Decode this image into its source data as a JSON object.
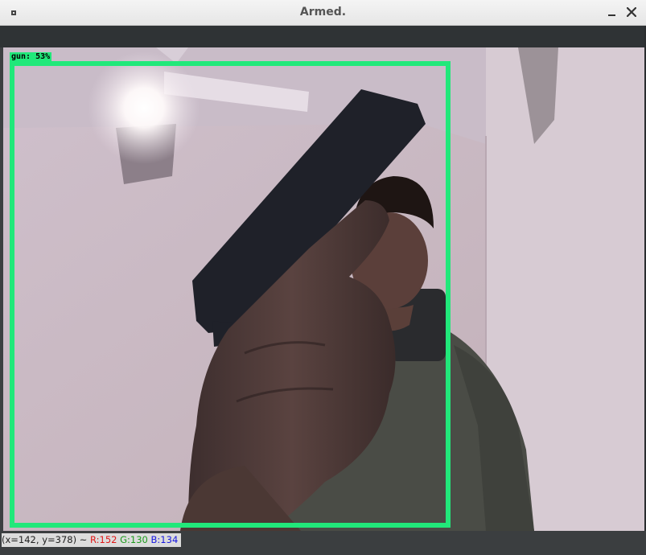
{
  "window": {
    "title": "Armed.",
    "icons": {
      "menu": "window-menu-icon",
      "minimize": "minimize-icon",
      "close": "close-icon"
    }
  },
  "detection": {
    "label": "gun:  53%",
    "color": "#21e87a"
  },
  "status": {
    "coords": "(x=142, y=378) ~",
    "r": "R:152",
    "g": "G:130",
    "b": "B:134",
    "colors": {
      "r": "#e01818",
      "g": "#1c9a1c",
      "b": "#1818e0"
    }
  }
}
